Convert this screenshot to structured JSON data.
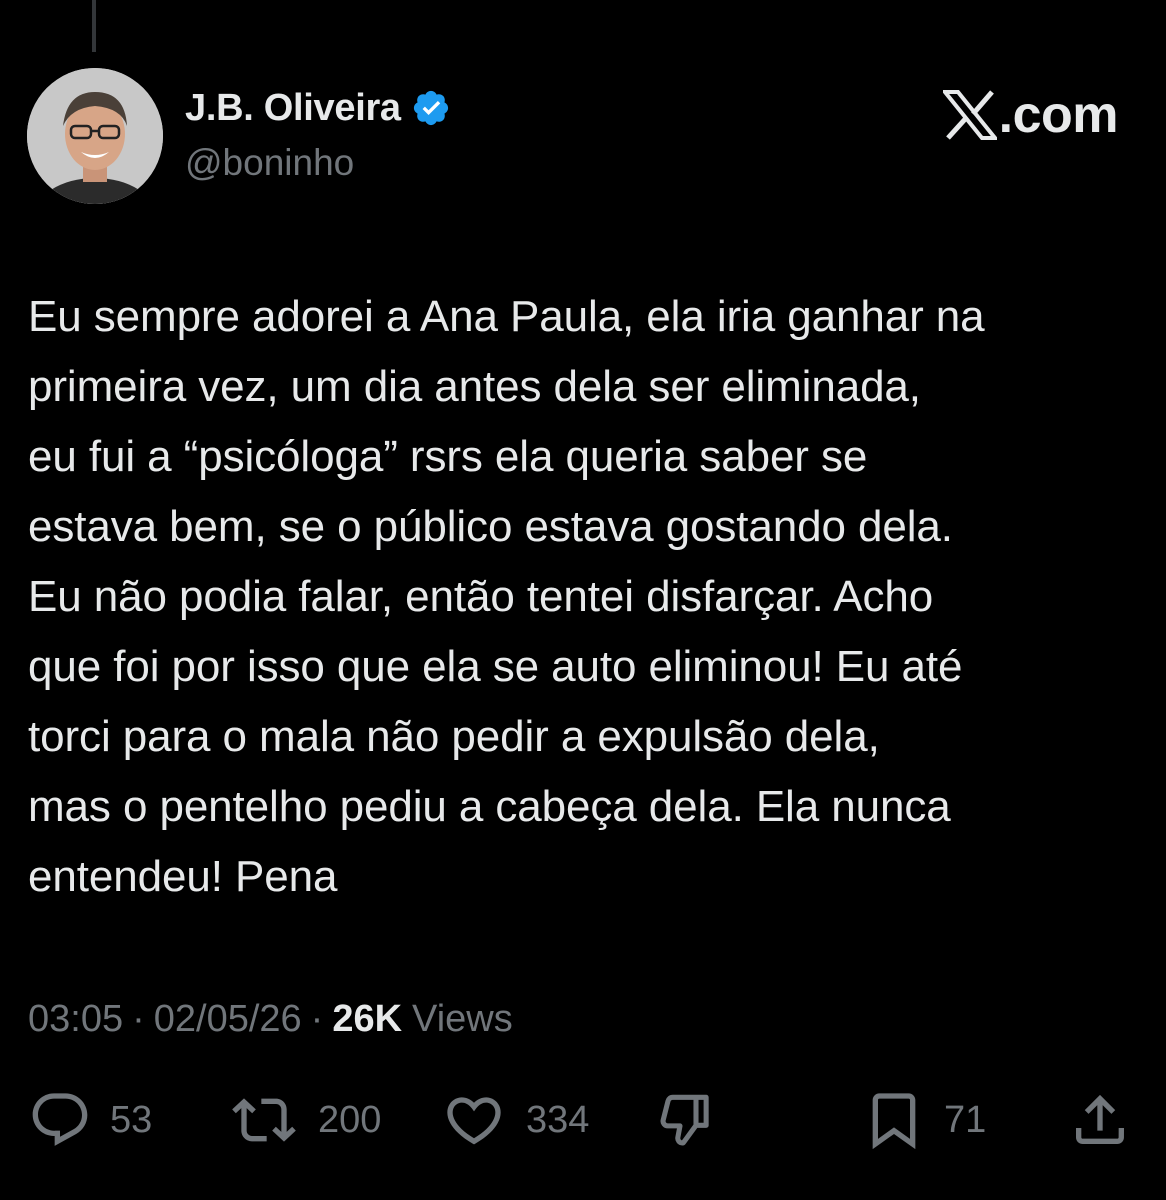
{
  "author": {
    "name": "J.B. Oliveira",
    "handle": "@boninho",
    "verified": true
  },
  "brand": {
    "domain": ".com",
    "logo_icon": "x-logo-icon"
  },
  "tweet": {
    "text": "Eu sempre adorei a Ana Paula, ela iria ganhar na\nprimeira vez, um dia antes dela ser eliminada,\neu fui a “psicóloga” rsrs ela queria saber se\nestava bem, se o público estava gostando dela.\nEu não podia falar, então tentei disfarçar. Acho\nque foi por isso que ela se auto eliminou! Eu até\ntorci para o mala não pedir a expulsão dela,\nmas o pentelho pediu a cabeça dela. Ela nunca\nentendeu! Pena",
    "time": "03:05",
    "date": "02/05/26",
    "separator": "·",
    "views_count": "26K",
    "views_label": "Views"
  },
  "actions": {
    "replies": "53",
    "reposts": "200",
    "likes": "334",
    "bookmarks": "71"
  },
  "colors": {
    "background": "#000000",
    "text_primary": "#e7e9ea",
    "text_secondary": "#71767b",
    "verified_blue": "#1d9bf0"
  }
}
